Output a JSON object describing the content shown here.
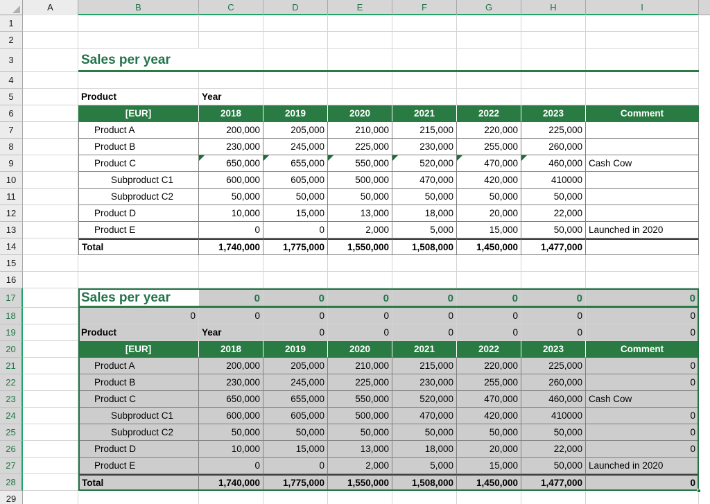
{
  "app": {
    "type": "spreadsheet"
  },
  "colors": {
    "header_green": "#2a7a43",
    "title_green": "#21734a",
    "selection_border": "#217346",
    "selection_fill": "#cdcdcd",
    "comment_marker": "#1f6b3b"
  },
  "column_headers": [
    {
      "label": "A",
      "selected": false
    },
    {
      "label": "B",
      "selected": true
    },
    {
      "label": "C",
      "selected": true
    },
    {
      "label": "D",
      "selected": true
    },
    {
      "label": "E",
      "selected": true
    },
    {
      "label": "F",
      "selected": true
    },
    {
      "label": "G",
      "selected": true
    },
    {
      "label": "H",
      "selected": true
    },
    {
      "label": "I",
      "selected": true
    }
  ],
  "row_headers": [
    {
      "label": "1",
      "selected": false
    },
    {
      "label": "2",
      "selected": false
    },
    {
      "label": "3",
      "selected": false
    },
    {
      "label": "4",
      "selected": false
    },
    {
      "label": "5",
      "selected": false
    },
    {
      "label": "6",
      "selected": false
    },
    {
      "label": "7",
      "selected": false
    },
    {
      "label": "8",
      "selected": false
    },
    {
      "label": "9",
      "selected": false
    },
    {
      "label": "10",
      "selected": false
    },
    {
      "label": "11",
      "selected": false
    },
    {
      "label": "12",
      "selected": false
    },
    {
      "label": "13",
      "selected": false
    },
    {
      "label": "14",
      "selected": false
    },
    {
      "label": "15",
      "selected": false
    },
    {
      "label": "16",
      "selected": false
    },
    {
      "label": "17",
      "selected": true
    },
    {
      "label": "18",
      "selected": true
    },
    {
      "label": "19",
      "selected": true
    },
    {
      "label": "20",
      "selected": true
    },
    {
      "label": "21",
      "selected": true
    },
    {
      "label": "22",
      "selected": true
    },
    {
      "label": "23",
      "selected": true
    },
    {
      "label": "24",
      "selected": true
    },
    {
      "label": "25",
      "selected": true
    },
    {
      "label": "26",
      "selected": true
    },
    {
      "label": "27",
      "selected": true
    },
    {
      "label": "28",
      "selected": true
    },
    {
      "label": "29",
      "selected": false
    }
  ],
  "table_one": {
    "title": "Sales per year",
    "label_product": "Product",
    "label_year": "Year",
    "header": {
      "unit": "[EUR]",
      "years": [
        "2018",
        "2019",
        "2020",
        "2021",
        "2022",
        "2023"
      ],
      "comment": "Comment"
    },
    "rows": [
      {
        "name": "Product A",
        "indent": 1,
        "values": [
          "200,000",
          "205,000",
          "210,000",
          "215,000",
          "220,000",
          "225,000"
        ],
        "comment": "",
        "marker": false
      },
      {
        "name": "Product B",
        "indent": 1,
        "values": [
          "230,000",
          "245,000",
          "225,000",
          "230,000",
          "255,000",
          "260,000"
        ],
        "comment": "",
        "marker": false
      },
      {
        "name": "Product C",
        "indent": 1,
        "values": [
          "650,000",
          "655,000",
          "550,000",
          "520,000",
          "470,000",
          "460,000"
        ],
        "comment": "Cash Cow",
        "marker": true
      },
      {
        "name": "Subproduct C1",
        "indent": 2,
        "values": [
          "600,000",
          "605,000",
          "500,000",
          "470,000",
          "420,000",
          "410000"
        ],
        "comment": "",
        "marker": false
      },
      {
        "name": "Subproduct C2",
        "indent": 2,
        "values": [
          "50,000",
          "50,000",
          "50,000",
          "50,000",
          "50,000",
          "50,000"
        ],
        "comment": "",
        "marker": false
      },
      {
        "name": "Product D",
        "indent": 1,
        "values": [
          "10,000",
          "15,000",
          "13,000",
          "18,000",
          "20,000",
          "22,000"
        ],
        "comment": "",
        "marker": false
      },
      {
        "name": "Product E",
        "indent": 1,
        "values": [
          "0",
          "0",
          "2,000",
          "5,000",
          "15,000",
          "50,000"
        ],
        "comment": "Launched in 2020",
        "marker": false
      }
    ],
    "total": {
      "name": "Total",
      "values": [
        "1,740,000",
        "1,775,000",
        "1,550,000",
        "1,508,000",
        "1,450,000",
        "1,477,000"
      ],
      "comment": ""
    }
  },
  "table_two": {
    "title": "Sales per year",
    "title_row_values": [
      "0",
      "0",
      "0",
      "0",
      "0",
      "0",
      "0"
    ],
    "blank_row_values": [
      "0",
      "0",
      "0",
      "0",
      "0",
      "0",
      "0",
      "0"
    ],
    "label_product": "Product",
    "label_year": "Year",
    "label_row_values": [
      "0",
      "0",
      "0",
      "0",
      "0",
      "0"
    ],
    "header": {
      "unit": "[EUR]",
      "years": [
        "2018",
        "2019",
        "2020",
        "2021",
        "2022",
        "2023"
      ],
      "comment": "Comment"
    },
    "rows": [
      {
        "name": "Product A",
        "indent": 1,
        "values": [
          "200,000",
          "205,000",
          "210,000",
          "215,000",
          "220,000",
          "225,000"
        ],
        "comment": "0",
        "marker": false
      },
      {
        "name": "Product B",
        "indent": 1,
        "values": [
          "230,000",
          "245,000",
          "225,000",
          "230,000",
          "255,000",
          "260,000"
        ],
        "comment": "0",
        "marker": false
      },
      {
        "name": "Product C",
        "indent": 1,
        "values": [
          "650,000",
          "655,000",
          "550,000",
          "520,000",
          "470,000",
          "460,000"
        ],
        "comment": "Cash Cow",
        "marker": false
      },
      {
        "name": "Subproduct C1",
        "indent": 2,
        "values": [
          "600,000",
          "605,000",
          "500,000",
          "470,000",
          "420,000",
          "410000"
        ],
        "comment": "0",
        "marker": false
      },
      {
        "name": "Subproduct C2",
        "indent": 2,
        "values": [
          "50,000",
          "50,000",
          "50,000",
          "50,000",
          "50,000",
          "50,000"
        ],
        "comment": "0",
        "marker": false
      },
      {
        "name": "Product D",
        "indent": 1,
        "values": [
          "10,000",
          "15,000",
          "13,000",
          "18,000",
          "20,000",
          "22,000"
        ],
        "comment": "0",
        "marker": false
      },
      {
        "name": "Product E",
        "indent": 1,
        "values": [
          "0",
          "0",
          "2,000",
          "5,000",
          "15,000",
          "50,000"
        ],
        "comment": "Launched in 2020",
        "marker": false
      }
    ],
    "total": {
      "name": "Total",
      "values": [
        "1,740,000",
        "1,775,000",
        "1,550,000",
        "1,508,000",
        "1,450,000",
        "1,477,000"
      ],
      "comment": "0"
    }
  }
}
